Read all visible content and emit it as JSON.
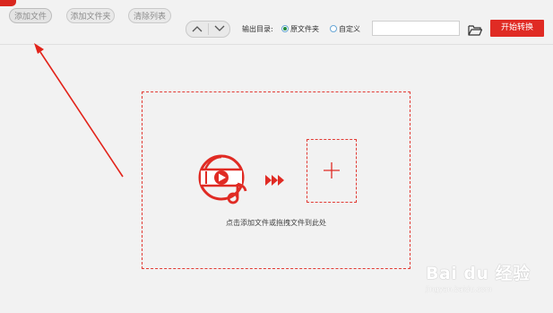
{
  "toolbar": {
    "add_file_label": "添加文件",
    "add_folder_label": "添加文件夹",
    "clear_list_label": "清除列表",
    "output_dir_label": "输出目录:",
    "option_original_folder": "原文件夹",
    "option_custom": "自定义",
    "selected_output_option": "原文件夹",
    "output_path_value": "",
    "start_convert_label": "开始转换"
  },
  "drop_zone": {
    "hint": "点击添加文件或拖拽文件到此处"
  },
  "icons": {
    "move_up": "chevron-up-icon",
    "move_down": "chevron-down-icon",
    "browse_folder": "folder-open-icon",
    "media": "video-music-disc-icon",
    "arrows": "triple-chevron-right-icon",
    "add": "plus-icon"
  },
  "colors": {
    "accent": "#e02b24",
    "radio_checked": "#1f8a3a"
  },
  "watermark": {
    "brand": "Bai du 经验",
    "url": "jingyan.baidu.com"
  }
}
